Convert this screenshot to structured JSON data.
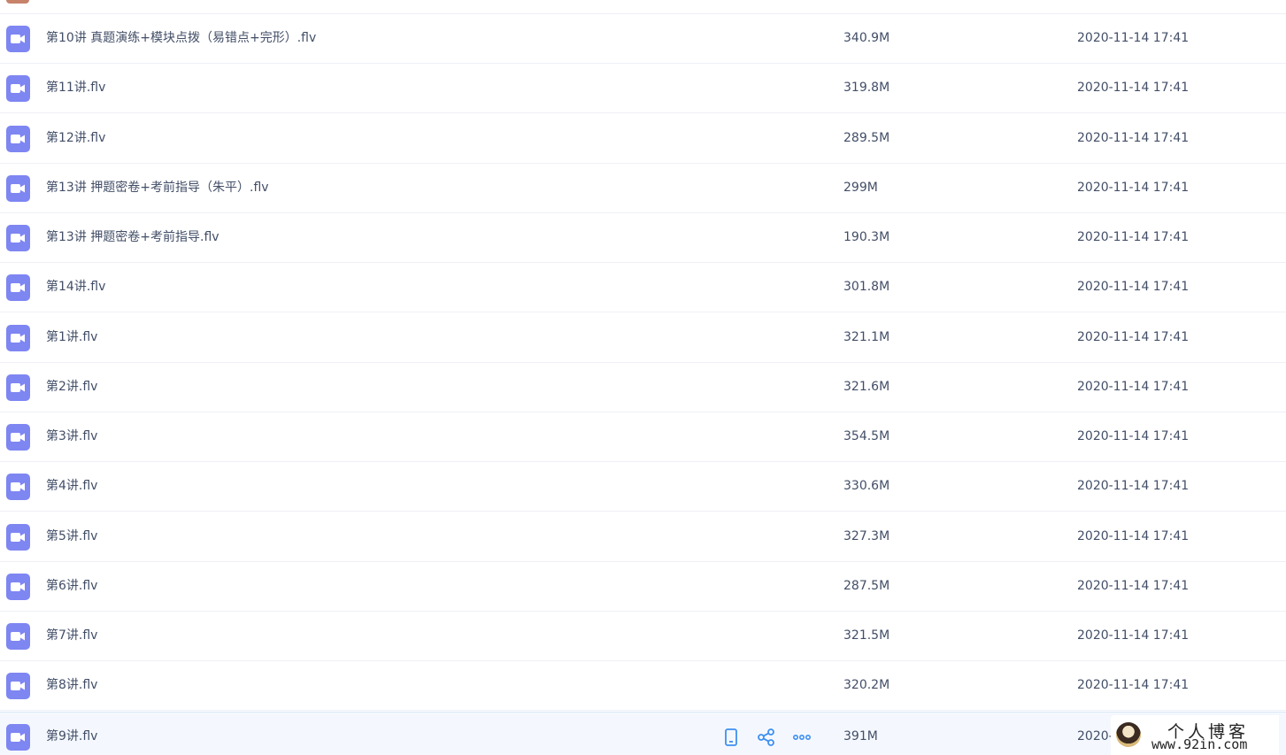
{
  "colors": {
    "video_icon": "#7e86f2",
    "text": "#424e67",
    "divider": "#eef0f6",
    "hover_row": "#f4f8fe",
    "action_icon": "#3e8ff0"
  },
  "files": [
    {
      "name": "第10讲 真题演练+模块点拨（易错点+完形）.flv",
      "size": "340.9M",
      "time": "2020-11-14 17:41",
      "icon": "video-file-icon"
    },
    {
      "name": "第11讲.flv",
      "size": "319.8M",
      "time": "2020-11-14 17:41",
      "icon": "video-file-icon"
    },
    {
      "name": "第12讲.flv",
      "size": "289.5M",
      "time": "2020-11-14 17:41",
      "icon": "video-file-icon"
    },
    {
      "name": "第13讲 押题密卷+考前指导（朱平）.flv",
      "size": "299M",
      "time": "2020-11-14 17:41",
      "icon": "video-file-icon"
    },
    {
      "name": "第13讲 押题密卷+考前指导.flv",
      "size": "190.3M",
      "time": "2020-11-14 17:41",
      "icon": "video-file-icon"
    },
    {
      "name": "第14讲.flv",
      "size": "301.8M",
      "time": "2020-11-14 17:41",
      "icon": "video-file-icon"
    },
    {
      "name": "第1讲.flv",
      "size": "321.1M",
      "time": "2020-11-14 17:41",
      "icon": "video-file-icon"
    },
    {
      "name": "第2讲.flv",
      "size": "321.6M",
      "time": "2020-11-14 17:41",
      "icon": "video-file-icon"
    },
    {
      "name": "第3讲.flv",
      "size": "354.5M",
      "time": "2020-11-14 17:41",
      "icon": "video-file-icon"
    },
    {
      "name": "第4讲.flv",
      "size": "330.6M",
      "time": "2020-11-14 17:41",
      "icon": "video-file-icon"
    },
    {
      "name": "第5讲.flv",
      "size": "327.3M",
      "time": "2020-11-14 17:41",
      "icon": "video-file-icon"
    },
    {
      "name": "第6讲.flv",
      "size": "287.5M",
      "time": "2020-11-14 17:41",
      "icon": "video-file-icon"
    },
    {
      "name": "第7讲.flv",
      "size": "321.5M",
      "time": "2020-11-14 17:41",
      "icon": "video-file-icon"
    },
    {
      "name": "第8讲.flv",
      "size": "320.2M",
      "time": "2020-11-14 17:41",
      "icon": "video-file-icon"
    },
    {
      "name": "第9讲.flv",
      "size": "391M",
      "time": "2020-",
      "icon": "video-file-icon"
    }
  ],
  "hover_actions": [
    {
      "icon": "phone-icon",
      "label": "send-to-phone"
    },
    {
      "icon": "share-icon",
      "label": "share"
    },
    {
      "icon": "more-icon",
      "label": "more"
    }
  ],
  "watermark": {
    "line1": "个人博客",
    "line2": "www.92in.com"
  }
}
